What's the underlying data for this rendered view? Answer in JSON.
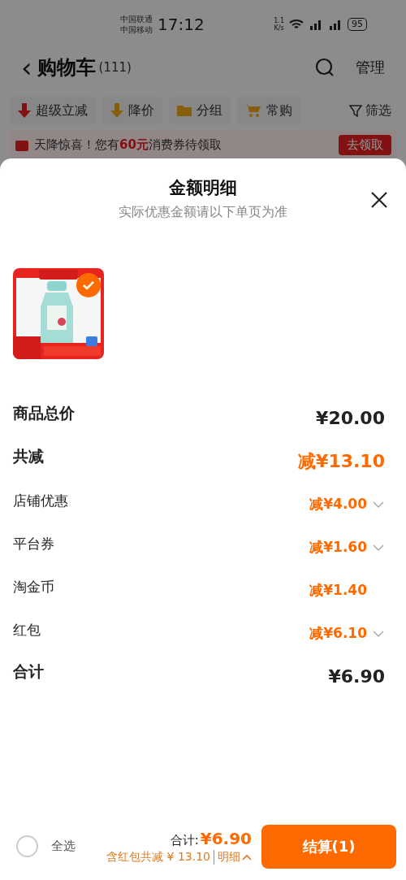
{
  "status_bar": {
    "carriers": [
      "中国联通",
      "中国移动"
    ],
    "time": "17:12",
    "net_speed": [
      "1.1",
      "K/s"
    ],
    "battery": "95"
  },
  "header": {
    "back_icon": "‹",
    "title": "购物车",
    "count": "(111)",
    "manage": "管理"
  },
  "filters": [
    {
      "label": "超级立减"
    },
    {
      "label": "降价"
    },
    {
      "label": "分组"
    },
    {
      "label": "常购"
    }
  ],
  "filter_button": "筛选",
  "banner": {
    "text": "天降惊喜！您有**60元**消费券待领取",
    "button": "去领取"
  },
  "sheet": {
    "title": "金额明细",
    "subtitle": "实际优惠金额请以下单页为准",
    "product": {
      "kind": "picture",
      "checked": true
    },
    "rows": [
      {
        "kind": "total",
        "label": "商品总价",
        "value": "¥20.00",
        "expandable": false
      },
      {
        "kind": "discount_total",
        "label": "共减",
        "value": "减¥13.10",
        "expandable": false
      },
      {
        "kind": "discount",
        "label": "店铺优惠",
        "value": "减¥4.00",
        "expandable": true
      },
      {
        "kind": "discount",
        "label": "平台券",
        "value": "减¥1.60",
        "expandable": true
      },
      {
        "kind": "discount",
        "label": "淘金币",
        "value": "减¥1.40",
        "expandable": false
      },
      {
        "kind": "discount",
        "label": "红包",
        "value": "减¥6.10",
        "expandable": true
      },
      {
        "kind": "total",
        "label": "合计",
        "value": "¥6.90",
        "expandable": false
      }
    ]
  },
  "footer": {
    "select_all": {
      "label": "全选",
      "checked": false
    },
    "total_label": "合计:",
    "total": "¥6.90",
    "savings": "含红包共减 ¥ 13.10",
    "details_link": "明细",
    "checkout": "结算(1)"
  }
}
